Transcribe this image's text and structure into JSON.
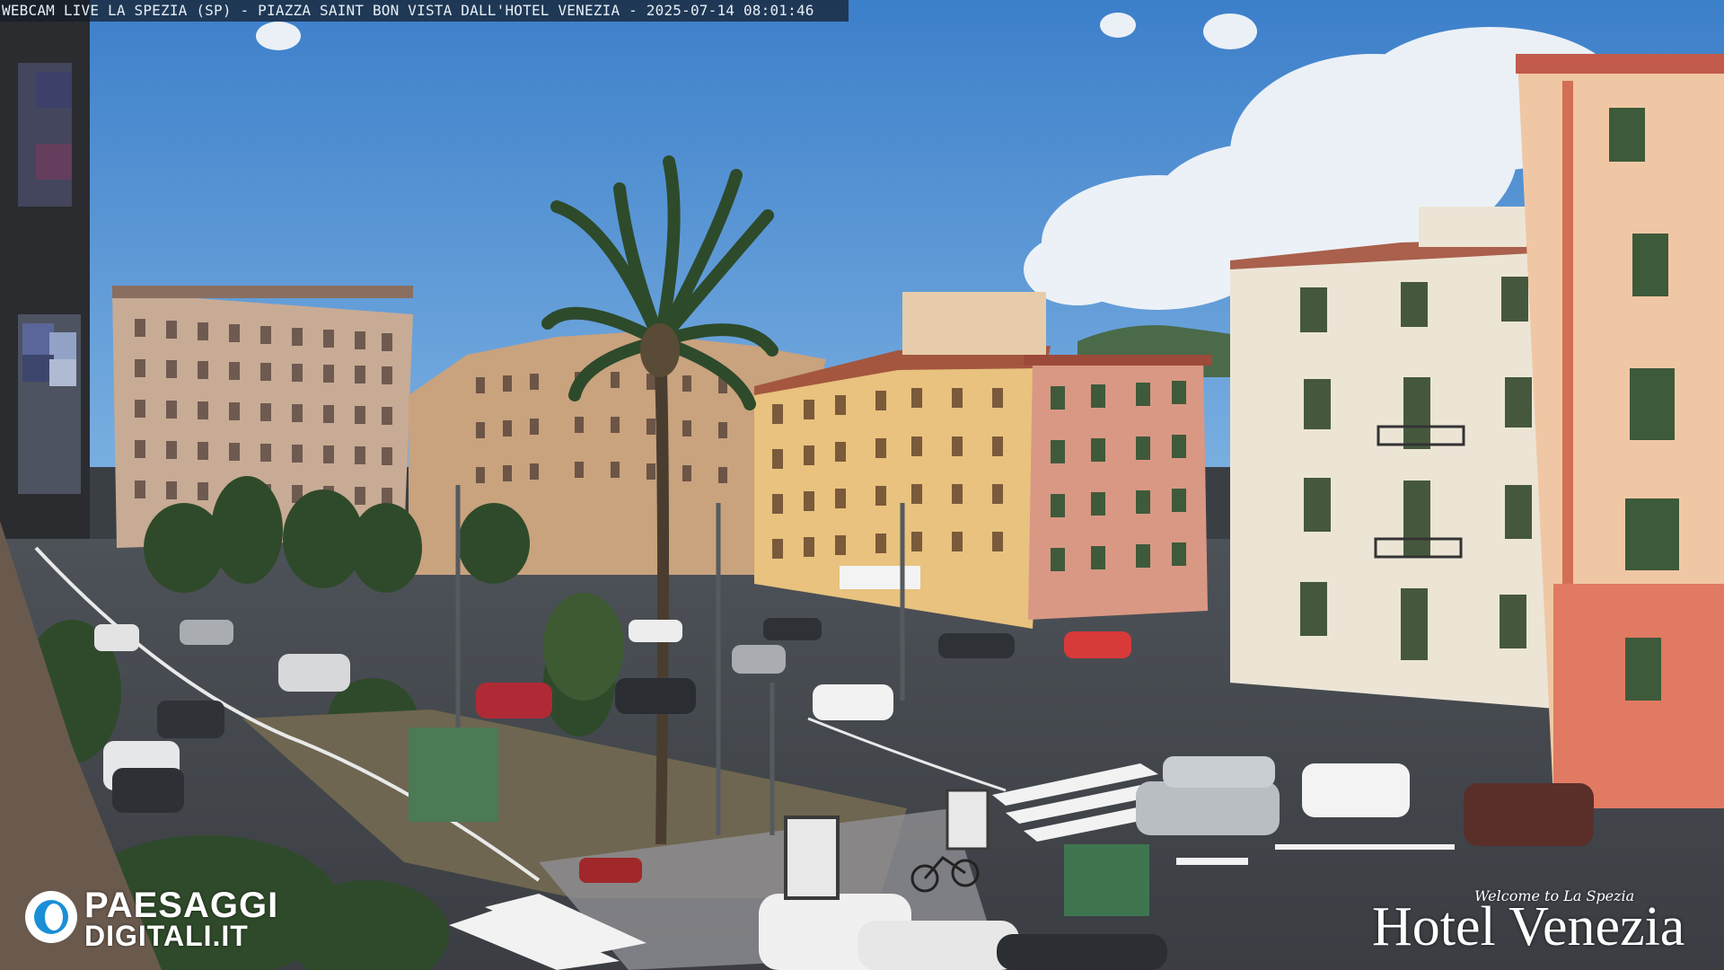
{
  "overlay": {
    "caption": "WEBCAM LIVE LA SPEZIA (SP) - PIAZZA SAINT BON VISTA DALL'HOTEL VENEZIA - 2025-07-14 08:01:46"
  },
  "branding": {
    "left_line1": "PAESAGGI",
    "left_line2": "DIGITALI.IT",
    "left_icon": "eye-logo-icon",
    "right_tagline": "Welcome to La Spezia",
    "right_name": "Hotel Venezia"
  },
  "colors": {
    "sky": "#4f8fd2",
    "logo_blue": "#1b8fd6"
  }
}
